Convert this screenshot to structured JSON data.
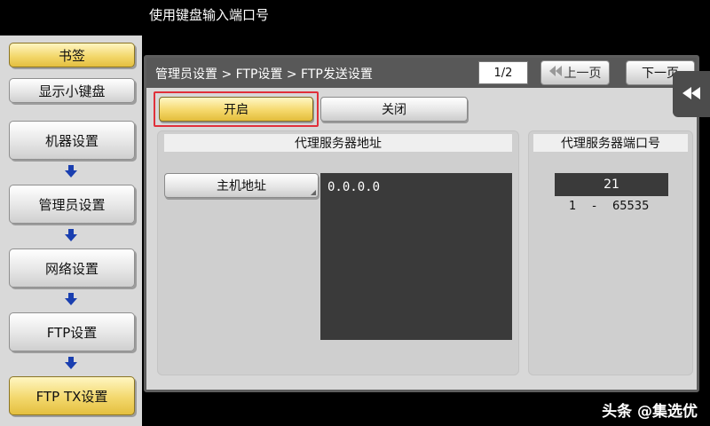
{
  "prompt": "使用键盘输入端口号",
  "left_panel": {
    "bookmark": "书签",
    "keypad": "显示小键盘",
    "steps": [
      "机器设置",
      "管理员设置",
      "网络设置",
      "FTP设置",
      "FTP TX设置"
    ]
  },
  "header": {
    "breadcrumb": "管理员设置 > FTP设置 > FTP发送设置",
    "page": "1/2",
    "prev": "上一页",
    "next": "下一页"
  },
  "toggle": {
    "on_label": "开启",
    "off_label": "关闭"
  },
  "proxy": {
    "title": "代理服务器地址",
    "host_button": "主机地址",
    "address": "0.0.0.0"
  },
  "port": {
    "title": "代理服务器端口号",
    "value": "21",
    "range_min": "1",
    "range_sep": "-",
    "range_max": "65535"
  },
  "watermark": "头条 @集选优",
  "colors": {
    "accent_yellow": "#f3d86d",
    "highlight_red": "#e0303a",
    "arrow_blue": "#1a3fb0"
  }
}
